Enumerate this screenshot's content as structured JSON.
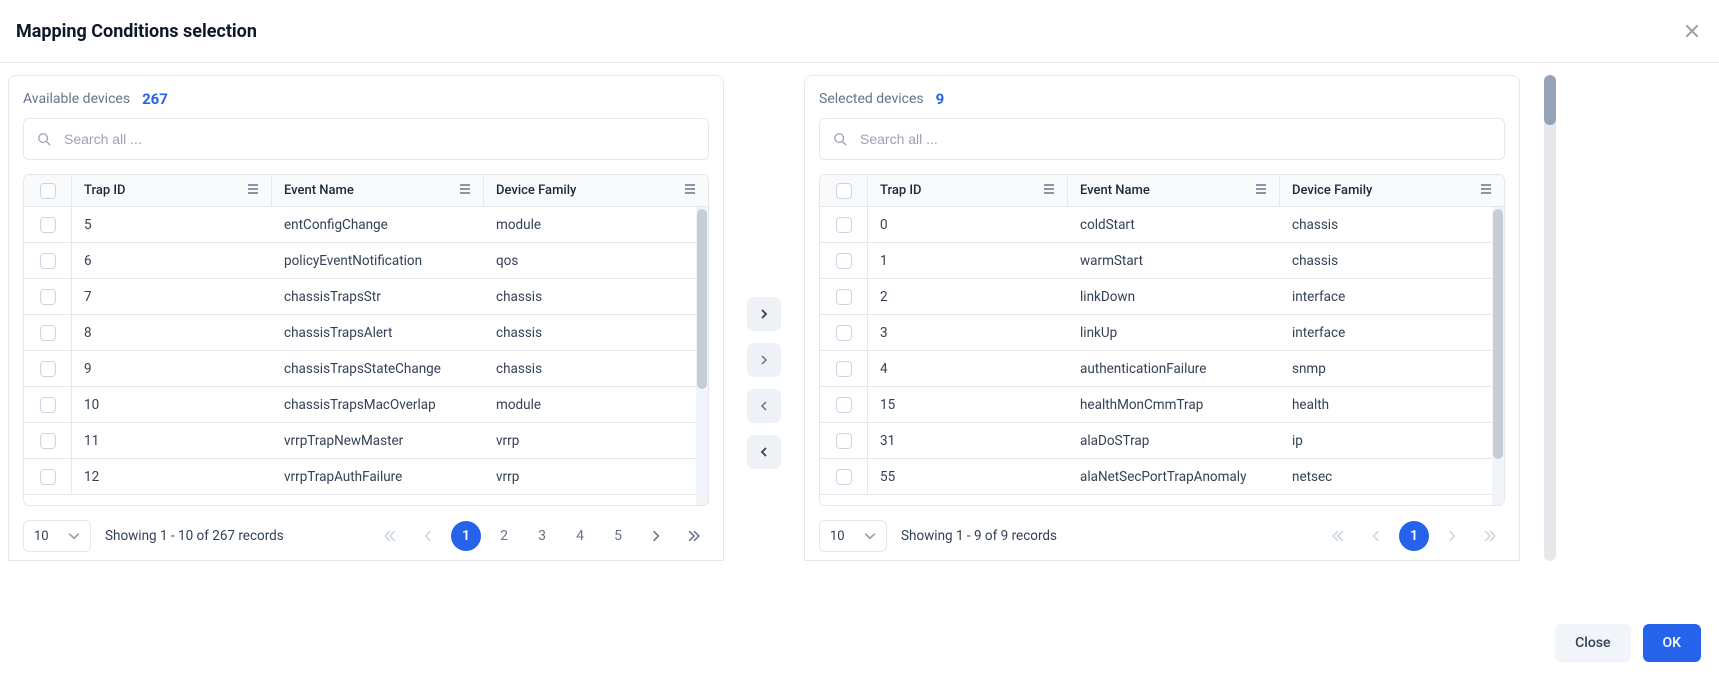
{
  "dialog": {
    "title": "Mapping Conditions selection"
  },
  "available": {
    "label": "Available devices",
    "count": "267",
    "search_placeholder": "Search all ...",
    "columns": {
      "trap": "Trap ID",
      "event": "Event Name",
      "family": "Device Family"
    },
    "rows": [
      {
        "trap": "5",
        "event": "entConfigChange",
        "family": "module"
      },
      {
        "trap": "6",
        "event": "policyEventNotification",
        "family": "qos"
      },
      {
        "trap": "7",
        "event": "chassisTrapsStr",
        "family": "chassis"
      },
      {
        "trap": "8",
        "event": "chassisTrapsAlert",
        "family": "chassis"
      },
      {
        "trap": "9",
        "event": "chassisTrapsStateChange",
        "family": "chassis"
      },
      {
        "trap": "10",
        "event": "chassisTrapsMacOverlap",
        "family": "module"
      },
      {
        "trap": "11",
        "event": "vrrpTrapNewMaster",
        "family": "vrrp"
      },
      {
        "trap": "12",
        "event": "vrrpTrapAuthFailure",
        "family": "vrrp"
      }
    ],
    "page_size": "10",
    "showing": "Showing 1 - 10 of 267 records",
    "pages": [
      "1",
      "2",
      "3",
      "4",
      "5"
    ]
  },
  "selected": {
    "label": "Selected devices",
    "count": "9",
    "search_placeholder": "Search all ...",
    "columns": {
      "trap": "Trap ID",
      "event": "Event Name",
      "family": "Device Family"
    },
    "rows": [
      {
        "trap": "0",
        "event": "coldStart",
        "family": "chassis"
      },
      {
        "trap": "1",
        "event": "warmStart",
        "family": "chassis"
      },
      {
        "trap": "2",
        "event": "linkDown",
        "family": "interface"
      },
      {
        "trap": "3",
        "event": "linkUp",
        "family": "interface"
      },
      {
        "trap": "4",
        "event": "authenticationFailure",
        "family": "snmp"
      },
      {
        "trap": "15",
        "event": "healthMonCmmTrap",
        "family": "health"
      },
      {
        "trap": "31",
        "event": "alaDoSTrap",
        "family": "ip"
      },
      {
        "trap": "55",
        "event": "alaNetSecPortTrapAnomaly",
        "family": "netsec"
      }
    ],
    "page_size": "10",
    "showing": "Showing 1 - 9 of 9 records",
    "pages": [
      "1"
    ]
  },
  "footer": {
    "close": "Close",
    "ok": "OK"
  }
}
